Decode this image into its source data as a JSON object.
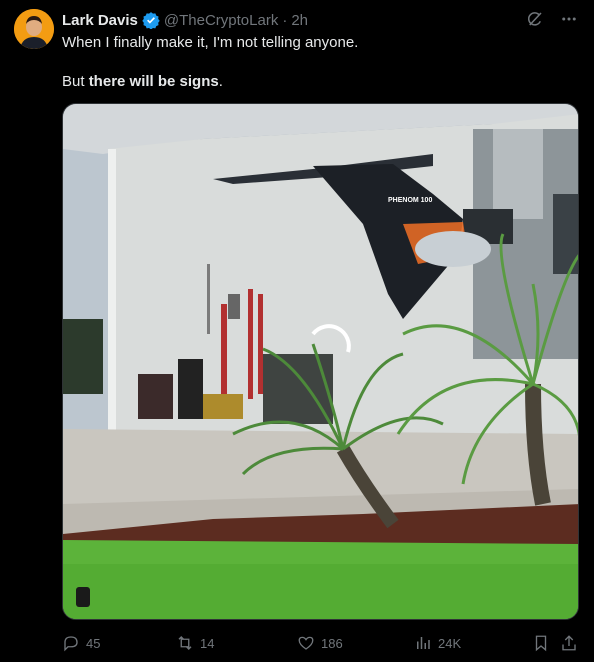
{
  "author": {
    "name": "Lark Davis",
    "handle": "@TheCryptoLark",
    "separator": "·",
    "time": "2h"
  },
  "tweet": {
    "line1": "When I finally make it, I'm not telling anyone.",
    "line2_prefix": "But ",
    "line2_bold": "there will be signs",
    "line2_suffix": "."
  },
  "media": {
    "jet_text": "PHENOM 100"
  },
  "stats": {
    "replies": "45",
    "reposts": "14",
    "likes": "186",
    "views": "24K"
  },
  "colors": {
    "background": "#000000",
    "text": "#e7e9ea",
    "muted": "#71767b",
    "verified": "#1d9bf0"
  }
}
